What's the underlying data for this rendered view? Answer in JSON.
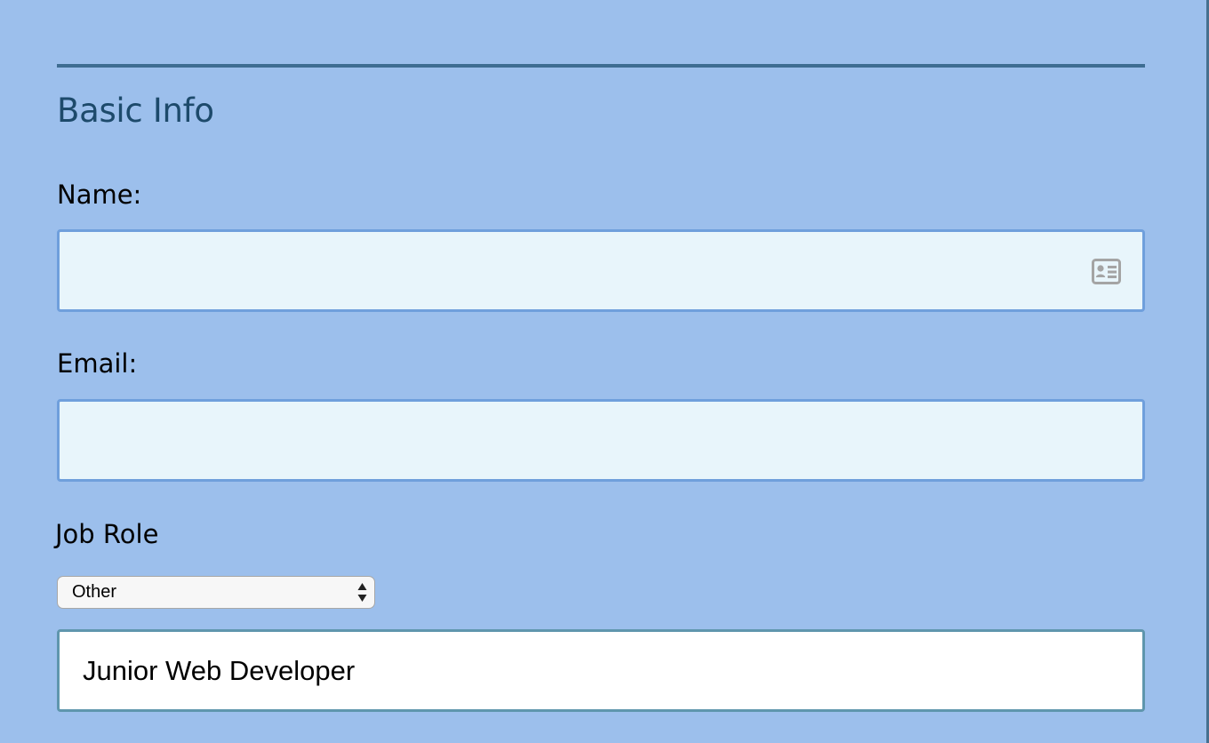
{
  "section": {
    "title": "Basic Info"
  },
  "fields": {
    "name": {
      "label": "Name:",
      "value": ""
    },
    "email": {
      "label": "Email:",
      "value": ""
    },
    "job_role": {
      "label": "Job Role",
      "selected": "Other",
      "other_value": "Junior Web Developer"
    }
  },
  "icons": {
    "name_field_icon": "contact-card-icon",
    "select_icon": "select-arrows-icon"
  },
  "colors": {
    "page_background": "#9cbfec",
    "heading": "#1d4a6b",
    "divider": "#3e6d92",
    "input_background": "#e8f5fb",
    "input_border": "#6f9fdc"
  }
}
